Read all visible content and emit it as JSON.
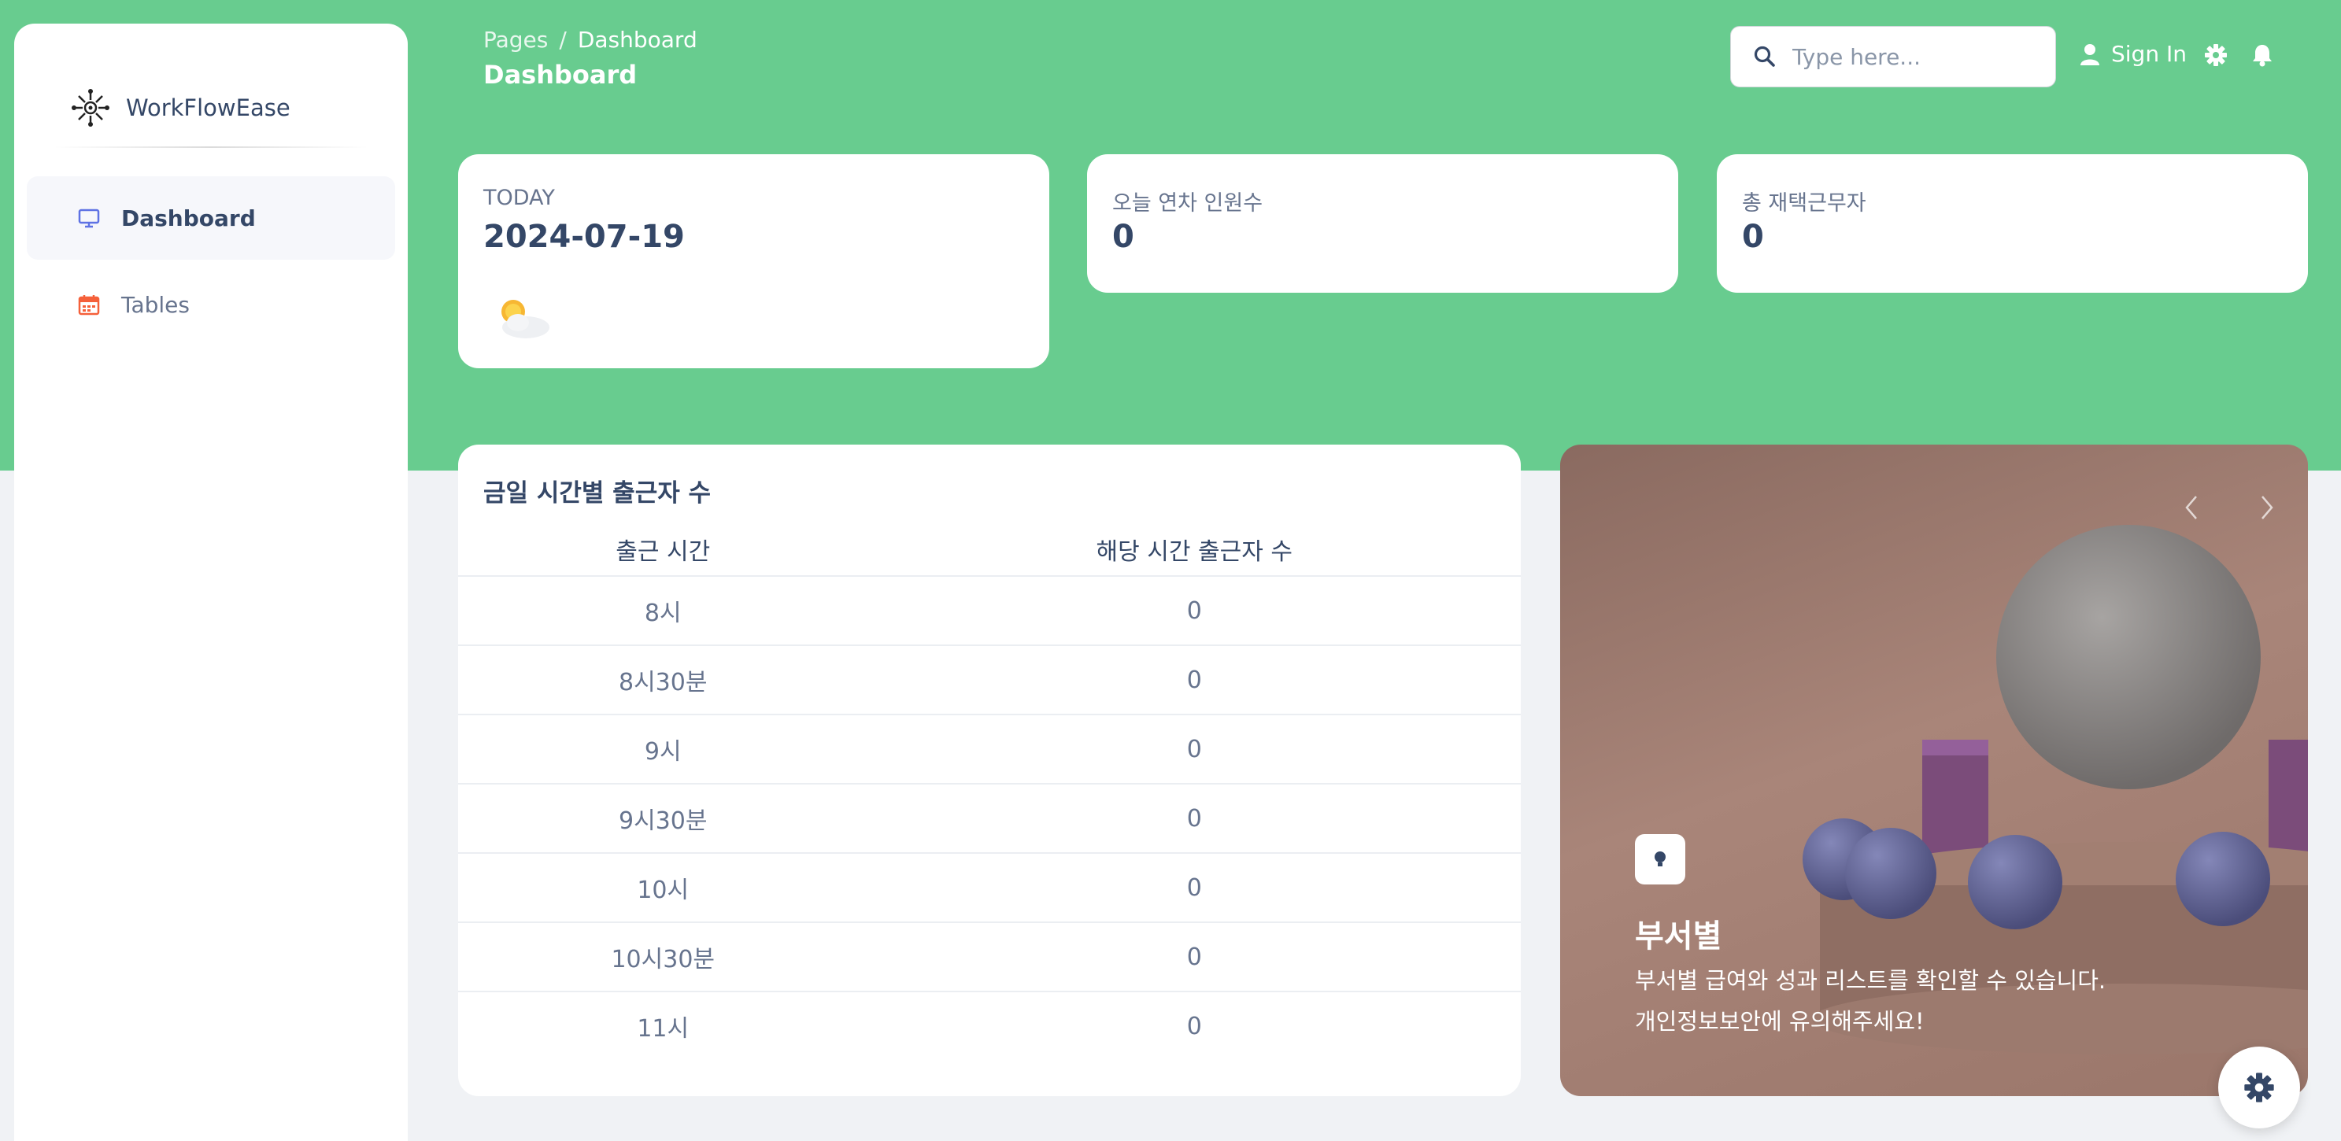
{
  "app": {
    "name": "WorkFlowEase"
  },
  "sidebar": {
    "items": [
      {
        "label": "Dashboard",
        "icon": "monitor-icon",
        "active": true
      },
      {
        "label": "Tables",
        "icon": "calendar-icon",
        "active": false
      }
    ]
  },
  "header": {
    "breadcrumb": {
      "parent": "Pages",
      "separator": "/",
      "current": "Dashboard"
    },
    "title": "Dashboard",
    "search_placeholder": "Type here...",
    "signin_label": "Sign In"
  },
  "stats": {
    "today": {
      "label": "TODAY",
      "value": "2024-07-19",
      "weather_icon": "partly-cloudy-icon"
    },
    "leave": {
      "label": "오늘 연차 인원수",
      "value": "0"
    },
    "remote": {
      "label": "총 재택근무자",
      "value": "0"
    }
  },
  "attendance": {
    "title": "금일 시간별 출근자 수",
    "columns": [
      "출근 시간",
      "해당 시간 출근자 수"
    ],
    "rows": [
      {
        "time": "8시",
        "count": "0"
      },
      {
        "time": "8시30분",
        "count": "0"
      },
      {
        "time": "9시",
        "count": "0"
      },
      {
        "time": "9시30분",
        "count": "0"
      },
      {
        "time": "10시",
        "count": "0"
      },
      {
        "time": "10시30분",
        "count": "0"
      },
      {
        "time": "11시",
        "count": "0"
      }
    ]
  },
  "feature": {
    "title": "부서별",
    "lines": [
      "부서별 급여와 성과 리스트를 확인할 수 있습니다.",
      "개인정보보안에 유의해주세요!"
    ],
    "icon": "lightbulb-icon"
  },
  "colors": {
    "accent": "#68cc8f",
    "text": "#344767",
    "muted": "#67748e"
  }
}
